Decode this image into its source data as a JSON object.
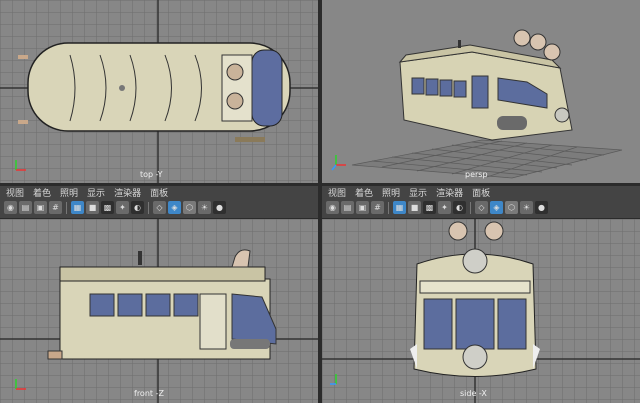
{
  "viewports": {
    "top": {
      "label": "top -Y"
    },
    "persp": {
      "label": "persp"
    },
    "front": {
      "label": "front -Z"
    },
    "side": {
      "label": "side -X"
    }
  },
  "panel_menu_left": [
    "视图",
    "着色",
    "照明",
    "显示",
    "渲染器",
    "面板"
  ],
  "panel_menu_right": [
    "视图",
    "着色",
    "照明",
    "显示",
    "渲染器",
    "面板"
  ],
  "toolbar_icons": [
    "camera-icon",
    "bookmark-icon",
    "film-icon",
    "grid-icon",
    "wireframe-icon",
    "smooth-shade-icon",
    "texture-icon",
    "light-icon",
    "shadow-icon",
    "xray-icon",
    "isolate-icon",
    "resolution-gate-icon"
  ],
  "colors": {
    "viewport_bg": "#878787",
    "grid": "#6f6f6f",
    "model": "#d8d4b6",
    "glass": "#5c6d9e"
  }
}
